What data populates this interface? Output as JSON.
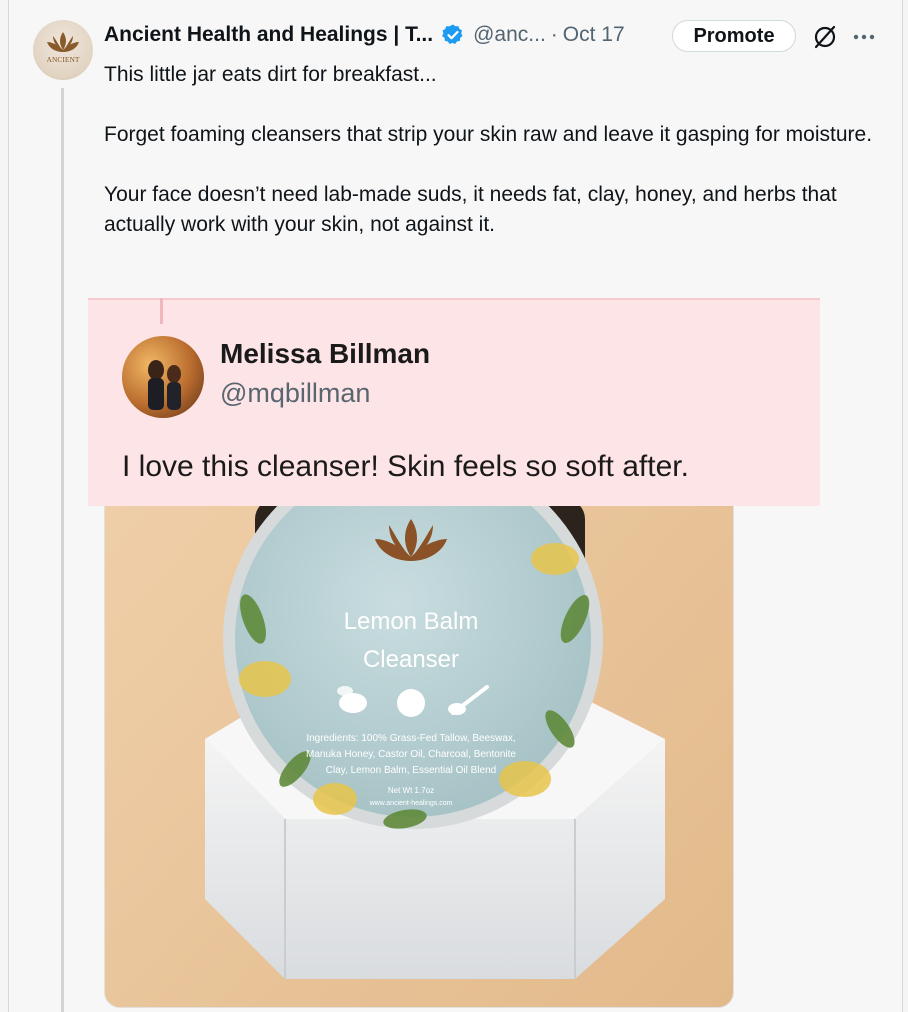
{
  "post": {
    "author": {
      "display_name": "Ancient Health and Healings | T...",
      "handle": "@anc...",
      "avatar_text": "ANCIENT",
      "verified_icon": "verified-badge-icon"
    },
    "separator": "·",
    "date": "Oct 17",
    "promote_label": "Promote",
    "body": [
      "This little jar eats dirt for breakfast...",
      "Forget foaming cleansers that strip your skin raw and leave it gasping for moisture.",
      "Your face doesn’t need lab-made suds, it needs fat, clay, honey, and herbs that actually work with your skin, not against it."
    ]
  },
  "media": {
    "quote": {
      "name": "Melissa Billman",
      "handle": "@mqbillman",
      "text": "I love this cleanser! Skin feels so soft after."
    },
    "product": {
      "title_line1": "Lemon Balm",
      "title_line2": "Cleanser",
      "ingredients_line1": "Ingredients: 100% Grass-Fed Tallow, Beeswax,",
      "ingredients_line2": "Manuka Honey, Castor Oil, Charcoal, Bentonite",
      "ingredients_line3": "Clay, Lemon Balm, Essential Oil Blend",
      "net_wt": "Net Wt 1.7oz",
      "website": "www.ancient-healings.com"
    }
  },
  "colors": {
    "accent": "#1d9bf0",
    "quote_background": "#fde4e6",
    "photo_background": "#ecc9a0"
  }
}
